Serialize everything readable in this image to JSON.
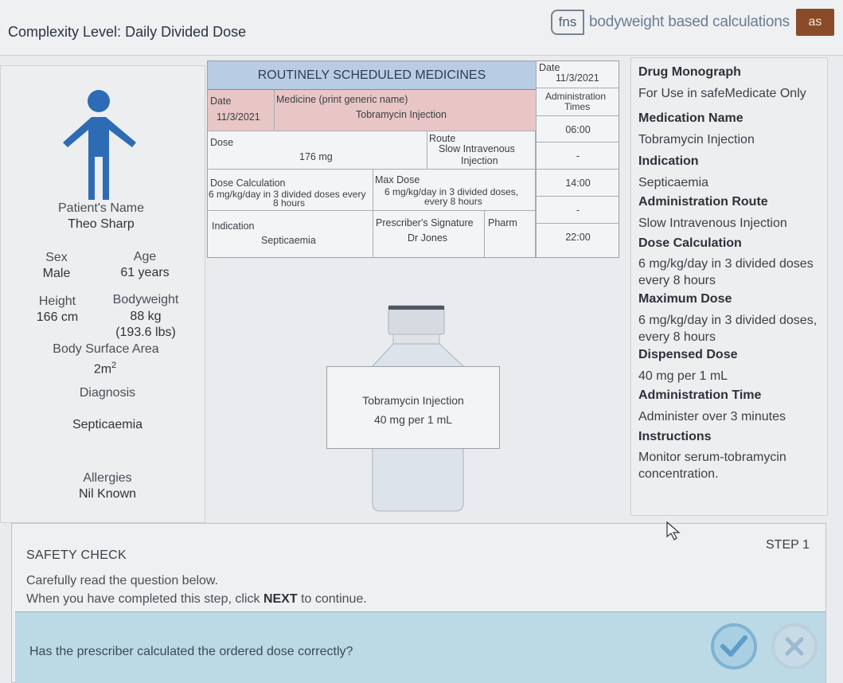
{
  "header": {
    "complexity_label": "Complexity Level:",
    "complexity_value": "Daily Divided Dose",
    "brand_logo": "fns",
    "brand_text": "bodyweight based calculations",
    "brand_badge": "as"
  },
  "patient": {
    "name_label": "Patient's Name",
    "name": "Theo Sharp",
    "sex_label": "Sex",
    "sex": "Male",
    "age_label": "Age",
    "age": "61 years",
    "height_label": "Height",
    "height": "166 cm",
    "bodyweight_label": "Bodyweight",
    "bodyweight": "88 kg",
    "bodyweight_lbs": "(193.6 lbs)",
    "bsa_label": "Body Surface Area",
    "bsa": "2m",
    "bsa_sup": "2",
    "diagnosis_label": "Diagnosis",
    "diagnosis": "Septicaemia",
    "allergies_label": "Allergies",
    "allergies": "Nil Known"
  },
  "mar": {
    "title": "ROUTINELY SCHEDULED MEDICINES",
    "date_label": "Date",
    "date": "11/3/2021",
    "medicine_label": "Medicine (print generic name)",
    "medicine": "Tobramycin Injection",
    "dose_label": "Dose",
    "dose": "176 mg",
    "route_label": "Route",
    "route_l1": "Slow Intravenous",
    "route_l2": "Injection",
    "dose_calc_label": "Dose Calculation",
    "dose_calc_l1": "6 mg/kg/day in 3 divided doses every",
    "dose_calc_l2": "8 hours",
    "max_dose_label": "Max Dose",
    "max_dose_l1": "6 mg/kg/day in 3 divided doses,",
    "max_dose_l2": "every 8 hours",
    "indication_label": "Indication",
    "indication": "Septicaemia",
    "prescriber_label": "Prescriber's Signature",
    "prescriber": "Dr Jones",
    "pharm_label": "Pharm",
    "times": {
      "date_label": "Date",
      "date": "11/3/2021",
      "admin_label_l1": "Administration",
      "admin_label_l2": "Times",
      "slots": [
        "06:00",
        "-",
        "14:00",
        "-",
        "22:00"
      ]
    }
  },
  "bottle": {
    "drug": "Tobramycin Injection",
    "strength": "40 mg per 1 mL"
  },
  "monograph": {
    "title": "Drug Monograph",
    "subtitle": "For Use in safeMedicate Only",
    "med_name_label": "Medication Name",
    "med_name": "Tobramycin Injection",
    "indication_label": "Indication",
    "indication": "Septicaemia",
    "route_label": "Administration Route",
    "route": "Slow Intravenous Injection",
    "dose_calc_label": "Dose Calculation",
    "dose_calc": "6 mg/kg/day in 3 divided doses every 8 hours",
    "max_dose_label": "Maximum Dose",
    "max_dose": "6 mg/kg/day in 3 divided doses, every 8 hours",
    "dispensed_label": "Dispensed Dose",
    "dispensed": "40 mg per 1 mL",
    "admin_time_label": "Administration Time",
    "admin_time": "Administer over 3 minutes",
    "instructions_label": "Instructions",
    "instructions": "Monitor serum-tobramycin concentration."
  },
  "safety": {
    "title": "SAFETY CHECK",
    "step": "STEP 1",
    "instr1": "Carefully read the question below.",
    "instr2_pre": "When you have completed this step, click",
    "instr2_bold": "NEXT",
    "instr2_post": "to continue.",
    "question": "Has the prescriber calculated the ordered dose correctly?"
  },
  "colors": {
    "mar_title_bg": "#b8cce4",
    "mar_pink_bg": "#e8c6c6",
    "person_icon": "#2d6cb5",
    "question_bar": "#bcd9e6"
  },
  "icons": [
    "person-icon",
    "bottle-icon",
    "check-icon",
    "cross-icon",
    "cursor-icon"
  ]
}
